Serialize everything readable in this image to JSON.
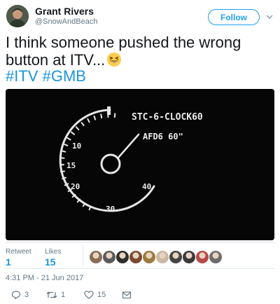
{
  "tweet": {
    "author_name": "Grant Rivers",
    "author_handle": "@SnowAndBeach",
    "follow_label": "Follow",
    "text": "I think someone pushed the wrong button at ITV...",
    "hashtags": [
      "#ITV",
      "#GMB"
    ],
    "timestamp": "4:31 PM - 21 Jun 2017"
  },
  "media": {
    "clock_title": "STC-6-CLOCK60",
    "clock_subtitle": "AFD6 60\"",
    "dial_labels": [
      "10",
      "15",
      "20",
      "30",
      "40"
    ]
  },
  "stats": {
    "retweets_label": "Retweet",
    "retweets_value": "1",
    "likes_label": "Likes",
    "likes_value": "15"
  },
  "actions": {
    "reply_count": "3",
    "retweet_count": "1",
    "like_count": "15"
  },
  "liker_avatars": [
    {
      "color": "#8a6d55"
    },
    {
      "color": "#5b5b5b"
    },
    {
      "color": "#2e2e2e"
    },
    {
      "color": "#7a4a2e"
    },
    {
      "color": "#9c7a3c"
    },
    {
      "color": "#c9b8a3"
    },
    {
      "color": "#444444"
    },
    {
      "color": "#3a3a3a"
    },
    {
      "color": "#b94a4a"
    },
    {
      "color": "#6d6d6d"
    }
  ],
  "icons": {
    "follow_caret": "chevron-down-icon",
    "emoji": "grinning-squinting-face",
    "reply": "reply-icon",
    "retweet": "retweet-icon",
    "like": "heart-icon",
    "dm": "envelope-icon"
  }
}
